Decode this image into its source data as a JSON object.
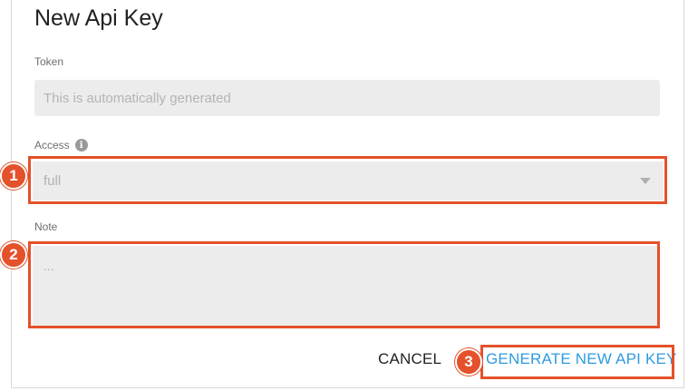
{
  "dialog": {
    "title": "New Api Key"
  },
  "token": {
    "label": "Token",
    "placeholder": "This is automatically generated"
  },
  "access": {
    "label": "Access",
    "value": "full"
  },
  "note": {
    "label": "Note",
    "placeholder": "..."
  },
  "actions": {
    "cancel_label": "CANCEL",
    "generate_label": "GENERATE NEW API KEY"
  },
  "annotations": {
    "step1": "1",
    "step2": "2",
    "step3": "3"
  },
  "colors": {
    "accent": "#2d9be0",
    "highlight": "#e4512a",
    "field_bg": "#ececec"
  },
  "icons": {
    "access_info": "info-icon",
    "access_dropdown": "chevron-down-icon"
  }
}
